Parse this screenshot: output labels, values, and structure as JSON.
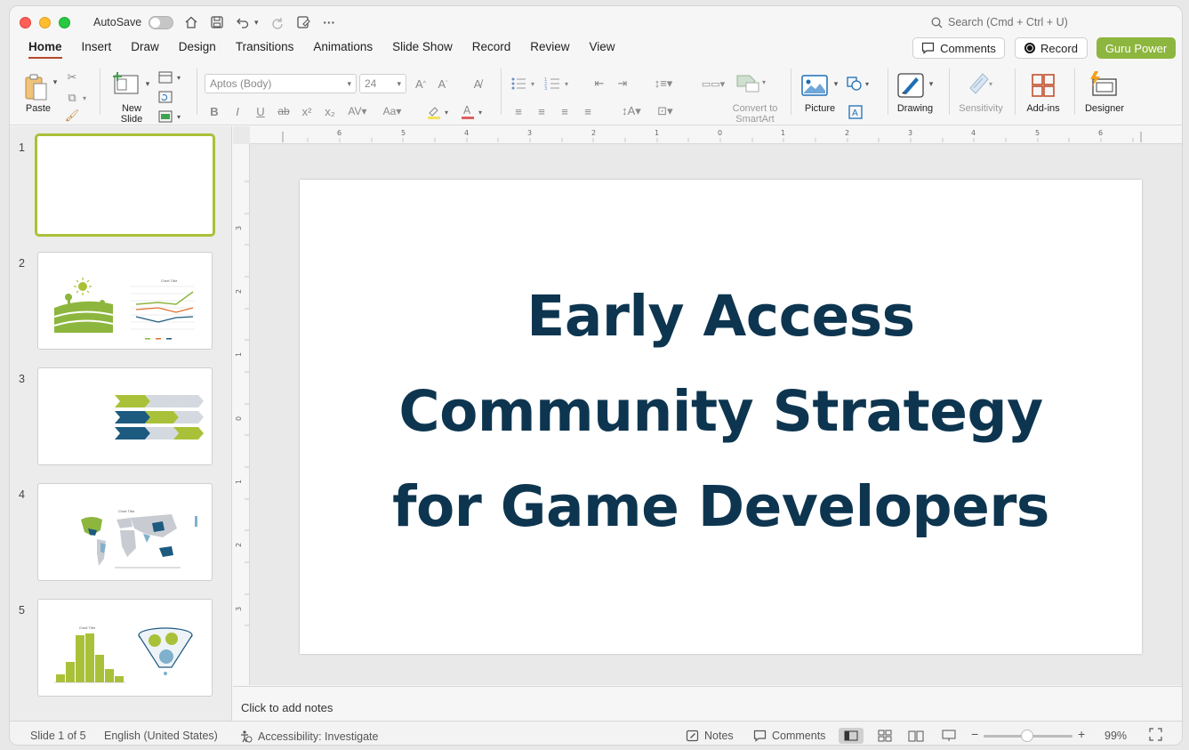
{
  "titlebar": {
    "autosave_label": "AutoSave",
    "search_placeholder": "Search (Cmd + Ctrl + U)"
  },
  "tabs": [
    {
      "label": "Home",
      "active": true
    },
    {
      "label": "Insert"
    },
    {
      "label": "Draw"
    },
    {
      "label": "Design"
    },
    {
      "label": "Transitions"
    },
    {
      "label": "Animations"
    },
    {
      "label": "Slide Show"
    },
    {
      "label": "Record"
    },
    {
      "label": "Review"
    },
    {
      "label": "View"
    }
  ],
  "top_buttons": {
    "comments": "Comments",
    "record": "Record",
    "guru": "Guru Power"
  },
  "ribbon": {
    "paste": "Paste",
    "new_slide": [
      "New",
      "Slide"
    ],
    "font_name": "Aptos (Body)",
    "font_size": "24",
    "convert_smartart": [
      "Convert to",
      "SmartArt"
    ],
    "picture": "Picture",
    "drawing": "Drawing",
    "sensitivity": "Sensitivity",
    "addins": "Add-ins",
    "designer": "Designer"
  },
  "slides": [
    {
      "number": "1",
      "selected": true
    },
    {
      "number": "2"
    },
    {
      "number": "3"
    },
    {
      "number": "4"
    },
    {
      "number": "5"
    }
  ],
  "slide": {
    "title_lines": [
      "Early Access",
      "Community Strategy",
      "for Game Developers"
    ],
    "title_color": "#0d3550"
  },
  "notes_placeholder": "Click to add notes",
  "status": {
    "slide_count": "Slide 1 of 5",
    "language": "English (United States)",
    "accessibility": "Accessibility: Investigate",
    "notes": "Notes",
    "comments": "Comments",
    "zoom": "99%"
  },
  "colors": {
    "accent_green": "#8db63e",
    "dark_blue": "#1d5a80",
    "tab_underline": "#b7472a"
  }
}
